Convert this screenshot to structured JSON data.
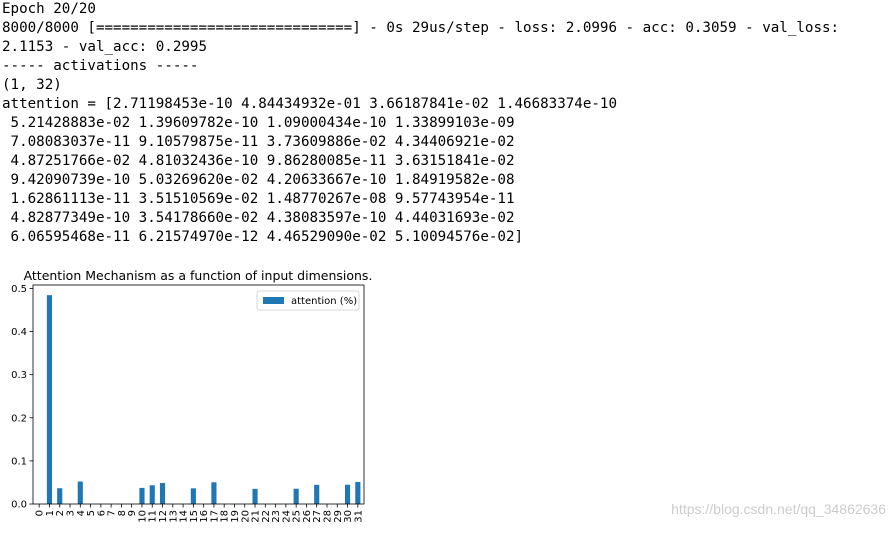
{
  "console": {
    "lines": [
      "Epoch 20/20",
      "8000/8000 [==============================] - 0s 29us/step - loss: 2.0996 - acc: 0.3059 - val_loss:",
      "2.1153 - val_acc: 0.2995",
      "----- activations -----",
      "(1, 32)",
      "attention = [2.71198453e-10 4.84434932e-01 3.66187841e-02 1.46683374e-10",
      " 5.21428883e-02 1.39609782e-10 1.09000434e-10 1.33899103e-09",
      " 7.08083037e-11 9.10579875e-11 3.73609886e-02 4.34406921e-02",
      " 4.87251766e-02 4.81032436e-10 9.86280085e-11 3.63151841e-02",
      " 9.42090739e-10 5.03269620e-02 4.20633667e-10 1.84919582e-08",
      " 1.62861113e-11 3.51510569e-02 1.48770267e-08 9.57743954e-11",
      " 4.82877349e-10 3.54178660e-02 4.38083597e-10 4.44031693e-02",
      " 6.06595468e-11 6.21574970e-12 4.46529090e-02 5.10094576e-02]"
    ]
  },
  "chart_data": {
    "type": "bar",
    "title": "Attention Mechanism as a function of input dimensions.",
    "categories": [
      "0",
      "1",
      "2",
      "3",
      "4",
      "5",
      "6",
      "7",
      "8",
      "9",
      "10",
      "11",
      "12",
      "13",
      "14",
      "15",
      "16",
      "17",
      "18",
      "19",
      "20",
      "21",
      "22",
      "23",
      "24",
      "25",
      "26",
      "27",
      "28",
      "29",
      "30",
      "31"
    ],
    "series": [
      {
        "name": "attention (%)",
        "color": "#1f77b4",
        "values": [
          2.71198453e-10,
          0.484434932,
          0.0366187841,
          1.46683374e-10,
          0.0521428883,
          1.39609782e-10,
          1.09000434e-10,
          1.33899103e-09,
          7.08083037e-11,
          9.10579875e-11,
          0.0373609886,
          0.0434406921,
          0.0487251766,
          4.81032436e-10,
          9.86280085e-11,
          0.0363151841,
          9.42090739e-10,
          0.050326962,
          4.20633667e-10,
          1.84919582e-08,
          1.62861113e-11,
          0.0351510569,
          1.48770267e-08,
          9.57743954e-11,
          4.82877349e-10,
          0.035417866,
          4.38083597e-10,
          0.0444031693,
          6.06595468e-11,
          6.2157497e-12,
          0.044652909,
          0.0510094576
        ]
      }
    ],
    "yticks": [
      "0.0",
      "0.1",
      "0.2",
      "0.3",
      "0.4",
      "0.5"
    ],
    "ylim": [
      0,
      0.508
    ],
    "legend": "top-right",
    "grid": false
  },
  "watermark": "https://blog.csdn.net/qq_34862636"
}
